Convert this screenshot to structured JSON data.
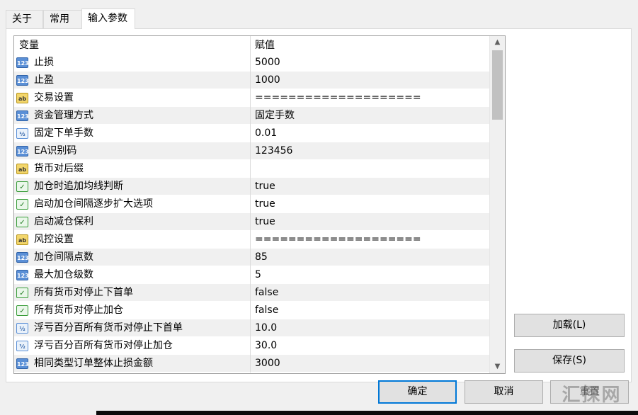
{
  "tabs": [
    "关于",
    "常用",
    "输入参数"
  ],
  "grid": {
    "headers": [
      "变量",
      "赋值"
    ],
    "rows": [
      {
        "icon": "int",
        "icon_text": "123",
        "name": "止损",
        "value": "5000"
      },
      {
        "icon": "int",
        "icon_text": "123",
        "name": "止盈",
        "value": "1000"
      },
      {
        "icon": "string",
        "icon_text": "ab",
        "name": "交易设置",
        "value": "===================="
      },
      {
        "icon": "int",
        "icon_text": "123",
        "name": "资金管理方式",
        "value": "固定手数"
      },
      {
        "icon": "double",
        "icon_text": "½",
        "name": "固定下单手数",
        "value": "0.01"
      },
      {
        "icon": "int",
        "icon_text": "123",
        "name": "EA识别码",
        "value": "123456"
      },
      {
        "icon": "string",
        "icon_text": "ab",
        "name": "货币对后缀",
        "value": ""
      },
      {
        "icon": "bool",
        "icon_text": "✓",
        "name": "加仓时追加均线判断",
        "value": "true"
      },
      {
        "icon": "bool",
        "icon_text": "✓",
        "name": "启动加仓间隔逐步扩大选项",
        "value": "true"
      },
      {
        "icon": "bool",
        "icon_text": "✓",
        "name": "启动减仓保利",
        "value": "true"
      },
      {
        "icon": "string",
        "icon_text": "ab",
        "name": "风控设置",
        "value": "===================="
      },
      {
        "icon": "int",
        "icon_text": "123",
        "name": "加仓间隔点数",
        "value": "85"
      },
      {
        "icon": "int",
        "icon_text": "123",
        "name": "最大加仓级数",
        "value": "5"
      },
      {
        "icon": "bool",
        "icon_text": "✓",
        "name": "所有货币对停止下首单",
        "value": "false"
      },
      {
        "icon": "bool",
        "icon_text": "✓",
        "name": "所有货币对停止加仓",
        "value": "false"
      },
      {
        "icon": "double",
        "icon_text": "½",
        "name": "浮亏百分百所有货币对停止下首单",
        "value": "10.0"
      },
      {
        "icon": "double",
        "icon_text": "½",
        "name": "浮亏百分百所有货币对停止加仓",
        "value": "30.0"
      },
      {
        "icon": "int",
        "icon_text": "123",
        "name": "相同类型订单整体止损金额",
        "value": "3000"
      }
    ]
  },
  "side_buttons": {
    "load": "加载(L)",
    "save": "保存(S)"
  },
  "footer": {
    "ok": "确定",
    "cancel": "取消",
    "reset": "重置"
  },
  "watermark": "汇探网"
}
